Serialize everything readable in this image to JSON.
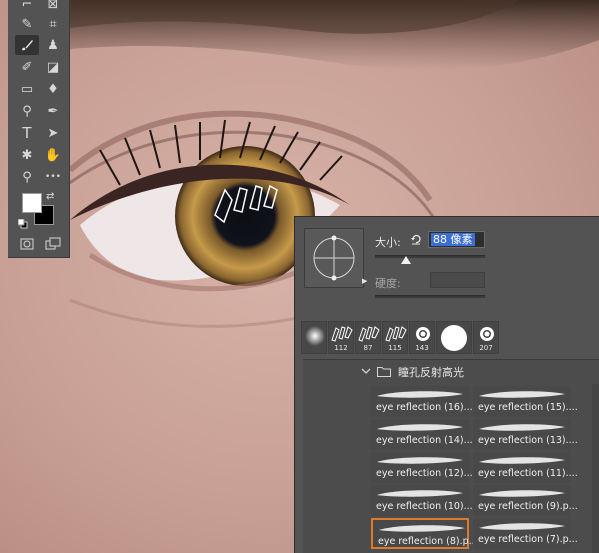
{
  "brush_panel": {
    "size_label": "大小:",
    "size_value": "88 像素",
    "hardness_label": "硬度:",
    "size_slider_percent": 28,
    "presets": [
      {
        "number": "",
        "icon": "soft-round-brush-icon"
      },
      {
        "number": "112",
        "icon": "eye-reflection-brush-icon"
      },
      {
        "number": "87",
        "icon": "eye-reflection-brush-icon"
      },
      {
        "number": "115",
        "icon": "eye-reflection-brush-icon"
      },
      {
        "number": "143",
        "icon": "ring-brush-icon"
      },
      {
        "number": "",
        "icon": "hard-round-brush-icon"
      },
      {
        "number": "207",
        "icon": "ring-brush-icon"
      }
    ],
    "group_name": "瞳孔反射高光",
    "brushes": [
      {
        "name": "eye reflection (16)...."
      },
      {
        "name": "eye reflection (15)...."
      },
      {
        "name": "eye reflection (14)...."
      },
      {
        "name": "eye reflection (13)...."
      },
      {
        "name": "eye reflection (12)...."
      },
      {
        "name": "eye reflection (11)...."
      },
      {
        "name": "eye reflection (10)...."
      },
      {
        "name": "eye reflection (9).p..."
      },
      {
        "name": "eye reflection (8).p...",
        "selected": true
      },
      {
        "name": "eye reflection (7).p..."
      }
    ]
  },
  "tools_panel": {
    "tools": [
      {
        "name": "lasso-tool-icon",
        "glyph": "⌐"
      },
      {
        "name": "frame-tool-icon",
        "glyph": "⊠"
      },
      {
        "name": "eyedropper-tool-icon",
        "glyph": "✎"
      },
      {
        "name": "patch-tool-icon",
        "glyph": "⌗"
      },
      {
        "name": "brush-tool-icon",
        "glyph": "",
        "active": true
      },
      {
        "name": "clone-stamp-tool-icon",
        "glyph": "♟"
      },
      {
        "name": "history-brush-tool-icon",
        "glyph": "✐"
      },
      {
        "name": "eraser-tool-icon",
        "glyph": "◪"
      },
      {
        "name": "gradient-tool-icon",
        "glyph": "▭"
      },
      {
        "name": "blur-tool-icon",
        "glyph": "♦"
      },
      {
        "name": "dodge-tool-icon",
        "glyph": "⚲"
      },
      {
        "name": "pen-tool-icon",
        "glyph": "✒"
      },
      {
        "name": "type-tool-icon",
        "glyph": "T"
      },
      {
        "name": "path-selection-tool-icon",
        "glyph": "➤"
      },
      {
        "name": "custom-shape-tool-icon",
        "glyph": "✱"
      },
      {
        "name": "hand-tool-icon",
        "glyph": "✋"
      },
      {
        "name": "zoom-tool-icon",
        "glyph": "⚲"
      },
      {
        "name": "more-tools-icon",
        "glyph": "•••"
      }
    ],
    "foreground_color": "#ffffff",
    "background_color": "#000000"
  },
  "colors": {
    "panel_bg": "#535353",
    "selection_orange": "#e07a2b",
    "input_highlight": "#3b6fd6"
  }
}
